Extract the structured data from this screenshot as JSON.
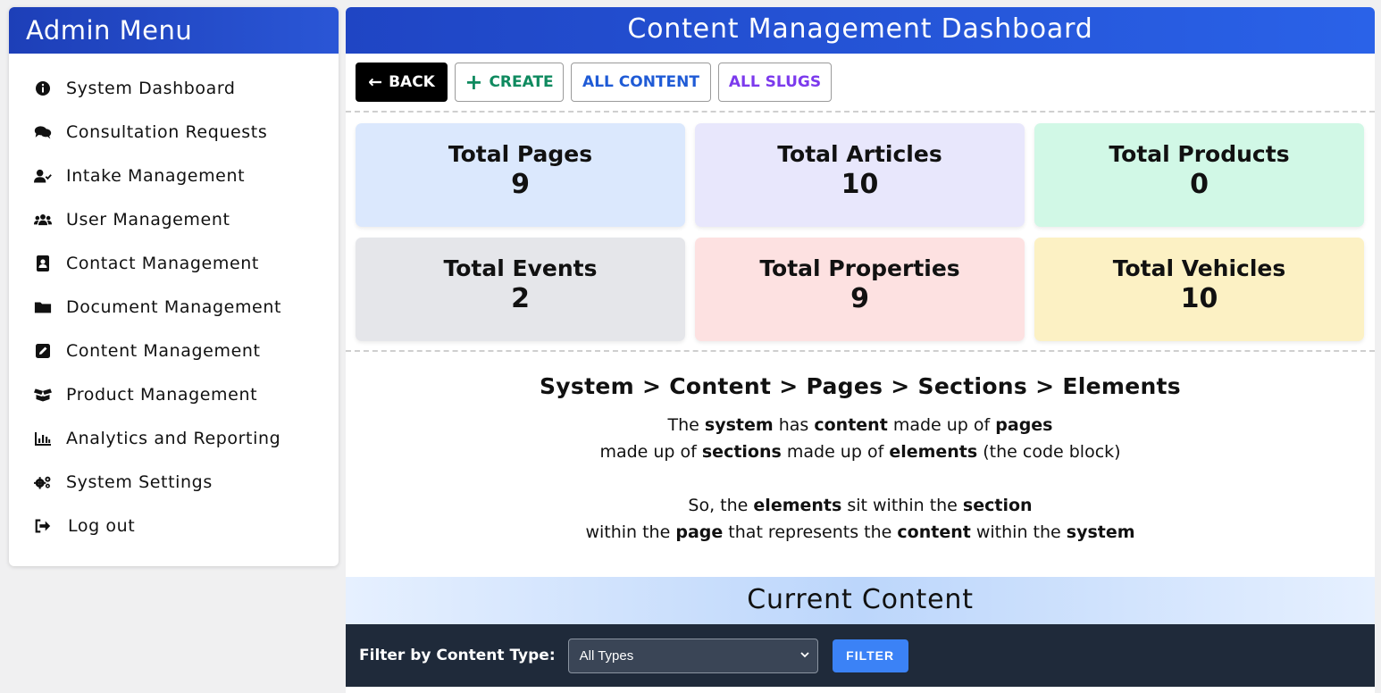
{
  "sidebar": {
    "title": "Admin Menu",
    "items": [
      {
        "label": "System Dashboard",
        "icon": "info-circle-icon"
      },
      {
        "label": "Consultation Requests",
        "icon": "comments-icon"
      },
      {
        "label": "Intake Management",
        "icon": "user-check-icon"
      },
      {
        "label": "User Management",
        "icon": "users-icon"
      },
      {
        "label": "Contact Management",
        "icon": "address-book-icon"
      },
      {
        "label": "Document Management",
        "icon": "folder-icon"
      },
      {
        "label": "Content Management",
        "icon": "edit-icon"
      },
      {
        "label": "Product Management",
        "icon": "box-open-icon"
      },
      {
        "label": "Analytics and Reporting",
        "icon": "chart-bar-icon"
      },
      {
        "label": "System Settings",
        "icon": "cogs-icon"
      },
      {
        "label": "Log out",
        "icon": "sign-out-icon"
      }
    ]
  },
  "main": {
    "title": "Content Management Dashboard",
    "toolbar": {
      "back_label": "BACK",
      "create_label": "CREATE",
      "all_content_label": "ALL CONTENT",
      "all_slugs_label": "ALL SLUGS"
    },
    "stats": [
      {
        "title": "Total Pages",
        "value": "9",
        "color": "#dbe8fd"
      },
      {
        "title": "Total Articles",
        "value": "10",
        "color": "#e8e7fc"
      },
      {
        "title": "Total Products",
        "value": "0",
        "color": "#d1f8e6"
      },
      {
        "title": "Total Events",
        "value": "2",
        "color": "#e5e6ea"
      },
      {
        "title": "Total Properties",
        "value": "9",
        "color": "#fde1e1"
      },
      {
        "title": "Total Vehicles",
        "value": "10",
        "color": "#fcf1c4"
      }
    ],
    "explain": {
      "title": "System > Content > Pages > Sections > Elements",
      "line1": {
        "t1": "The ",
        "b1": "system",
        "t2": " has ",
        "b2": "content",
        "t3": " made up of ",
        "b3": "pages"
      },
      "line2": {
        "t1": "made up of ",
        "b1": "sections",
        "t2": " made up of ",
        "b2": "elements",
        "t3": " (the code block)"
      },
      "line3": {
        "t1": "So, the ",
        "b1": "elements",
        "t2": " sit within the ",
        "b2": "section"
      },
      "line4": {
        "t1": "within the ",
        "b1": "page",
        "t2": " that represents the ",
        "b2": "content",
        "t3": " within the ",
        "b3": "system"
      }
    },
    "current_content": {
      "title": "Current Content",
      "filter_label": "Filter by Content Type:",
      "filter_value": "All Types",
      "filter_button": "FILTER"
    }
  }
}
